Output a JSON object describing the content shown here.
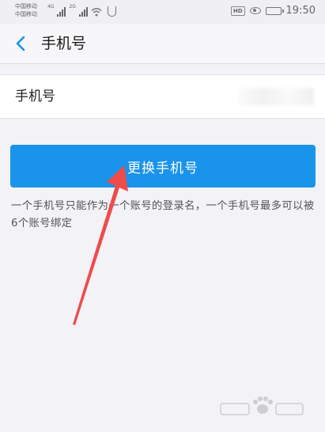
{
  "status_bar": {
    "carrier_1": "中国移动",
    "carrier_2": "中国移动",
    "network_1": "4G",
    "network_2": "2G",
    "time": "19:50",
    "hd_label": "HD"
  },
  "nav": {
    "title": "手机号",
    "back_icon": "chevron-left-icon"
  },
  "phone_row": {
    "label": "手机号",
    "value": ""
  },
  "actions": {
    "change_phone_label": "更换手机号"
  },
  "hint": {
    "text": "一个手机号只能作为一个账号的登录名，一个手机号最多可以被6个账号绑定"
  },
  "colors": {
    "accent": "#1a93ea",
    "annotation": "#ef4b4b",
    "background": "#f2f2f7"
  }
}
